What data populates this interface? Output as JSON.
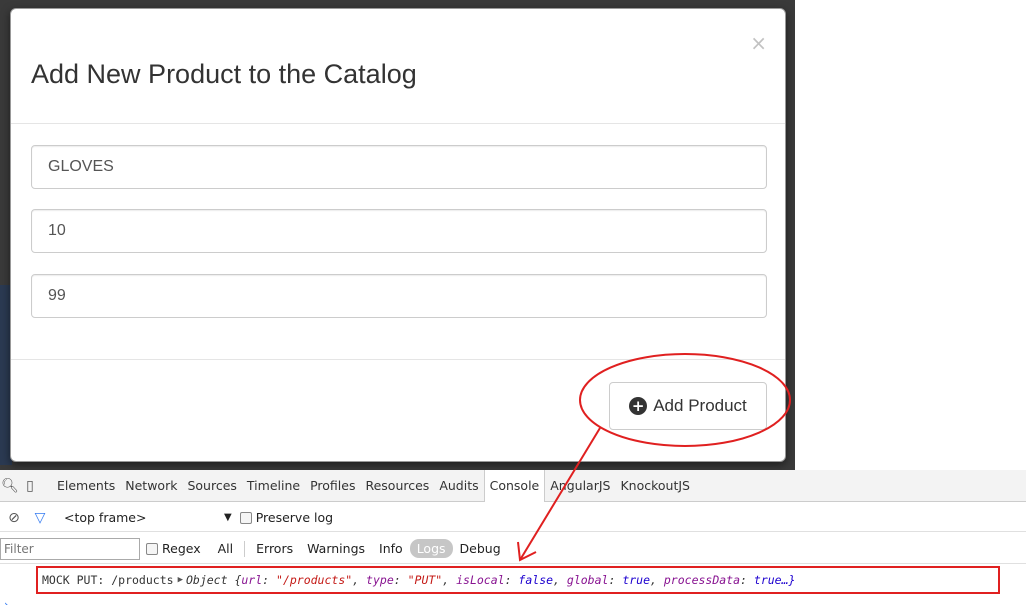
{
  "modal": {
    "title": "Add New Product to the Catalog",
    "close_glyph": "×",
    "fields": [
      {
        "value": "GLOVES"
      },
      {
        "value": "10"
      },
      {
        "value": "99"
      }
    ],
    "add_button_label": "Add Product",
    "add_button_icon": "plus-circle-icon"
  },
  "devtools": {
    "tabs": [
      "Elements",
      "Network",
      "Sources",
      "Timeline",
      "Profiles",
      "Resources",
      "Audits",
      "Console",
      "AngularJS",
      "KnockoutJS"
    ],
    "active_tab": "Console",
    "frame_label": "<top frame>",
    "preserve_log_label": "Preserve log",
    "filter_placeholder": "Filter",
    "regex_label": "Regex",
    "levels": [
      "All",
      "Errors",
      "Warnings",
      "Info",
      "Logs",
      "Debug"
    ],
    "selected_level": "Logs",
    "console_line": {
      "message": "MOCK PUT: /products",
      "object_prefix": "Object {",
      "k1": "url",
      "v1": "\"/products\"",
      "k2": "type",
      "v2": "\"PUT\"",
      "k3": "isLocal",
      "v3": "false",
      "k4": "global",
      "v4": "true",
      "k5": "processData",
      "v5": "true…}"
    }
  },
  "colors": {
    "annotation_red": "#e02020",
    "backdrop": "#3a3a3a"
  }
}
